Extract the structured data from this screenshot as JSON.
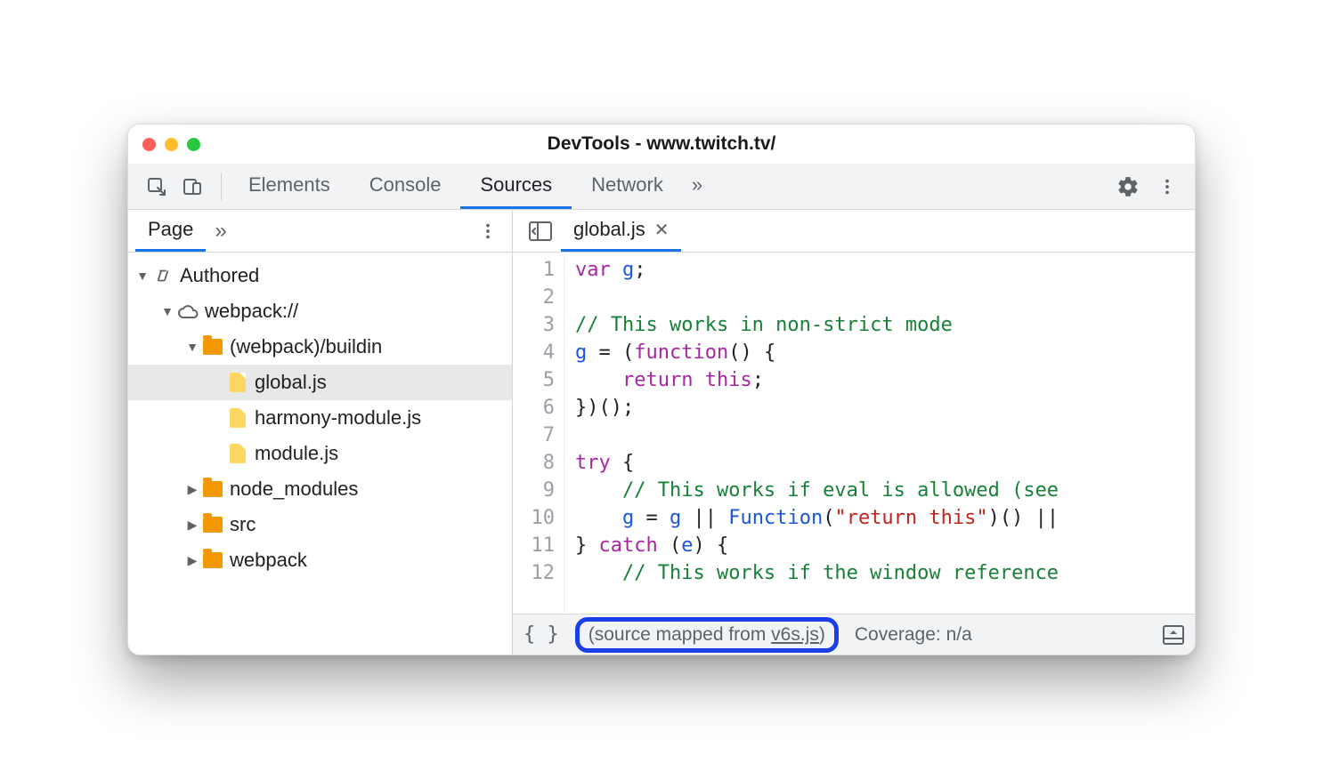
{
  "window": {
    "title": "DevTools - www.twitch.tv/"
  },
  "mainTabs": {
    "items": [
      "Elements",
      "Console",
      "Sources",
      "Network"
    ],
    "activeIndex": 2,
    "overflow": "»"
  },
  "sidebar": {
    "tabs": {
      "items": [
        "Page"
      ],
      "activeIndex": 0,
      "overflow": "»"
    },
    "tree": [
      {
        "label": "Authored",
        "type": "authored",
        "depth": 0,
        "expanded": true
      },
      {
        "label": "webpack://",
        "type": "domain",
        "depth": 1,
        "expanded": true
      },
      {
        "label": "(webpack)/buildin",
        "type": "folder",
        "depth": 2,
        "expanded": true
      },
      {
        "label": "global.js",
        "type": "file",
        "depth": 3,
        "selected": true
      },
      {
        "label": "harmony-module.js",
        "type": "file",
        "depth": 3
      },
      {
        "label": "module.js",
        "type": "file",
        "depth": 3
      },
      {
        "label": "node_modules",
        "type": "folder",
        "depth": 2,
        "expanded": false
      },
      {
        "label": "src",
        "type": "folder",
        "depth": 2,
        "expanded": false
      },
      {
        "label": "webpack",
        "type": "folder",
        "depth": 2,
        "expanded": false
      }
    ]
  },
  "editor": {
    "openFile": "global.js",
    "lines": [
      [
        [
          "kw",
          "var"
        ],
        [
          "sp",
          " "
        ],
        [
          "id",
          "g"
        ],
        [
          "pn",
          ";"
        ]
      ],
      [],
      [
        [
          "cm",
          "// This works in non-strict mode"
        ]
      ],
      [
        [
          "id",
          "g"
        ],
        [
          "sp",
          " "
        ],
        [
          "pn",
          "= ("
        ],
        [
          "kw2",
          "function"
        ],
        [
          "pn",
          "() {"
        ]
      ],
      [
        [
          "sp",
          "    "
        ],
        [
          "kw2",
          "return"
        ],
        [
          "sp",
          " "
        ],
        [
          "kw",
          "this"
        ],
        [
          "pn",
          ";"
        ]
      ],
      [
        [
          "pn",
          "})();"
        ]
      ],
      [],
      [
        [
          "kw2",
          "try"
        ],
        [
          "sp",
          " "
        ],
        [
          "pn",
          "{"
        ]
      ],
      [
        [
          "sp",
          "    "
        ],
        [
          "cm",
          "// This works if eval is allowed (see"
        ]
      ],
      [
        [
          "sp",
          "    "
        ],
        [
          "id",
          "g"
        ],
        [
          "sp",
          " "
        ],
        [
          "pn",
          "= "
        ],
        [
          "id",
          "g"
        ],
        [
          "sp",
          " "
        ],
        [
          "pn",
          "|| "
        ],
        [
          "fn",
          "Function"
        ],
        [
          "pn",
          "("
        ],
        [
          "str",
          "\"return this\""
        ],
        [
          "pn",
          ")() ||"
        ]
      ],
      [
        [
          "pn",
          "} "
        ],
        [
          "kw2",
          "catch"
        ],
        [
          "sp",
          " "
        ],
        [
          "pn",
          "("
        ],
        [
          "id",
          "e"
        ],
        [
          "pn",
          ") {"
        ]
      ],
      [
        [
          "sp",
          "    "
        ],
        [
          "cm",
          "// This works if the window reference"
        ]
      ]
    ]
  },
  "status": {
    "sourceMappedPrefix": "(source mapped from ",
    "sourceMappedLink": "v6s.js",
    "sourceMappedSuffix": ")",
    "coverageLabel": "Coverage: n/a"
  }
}
